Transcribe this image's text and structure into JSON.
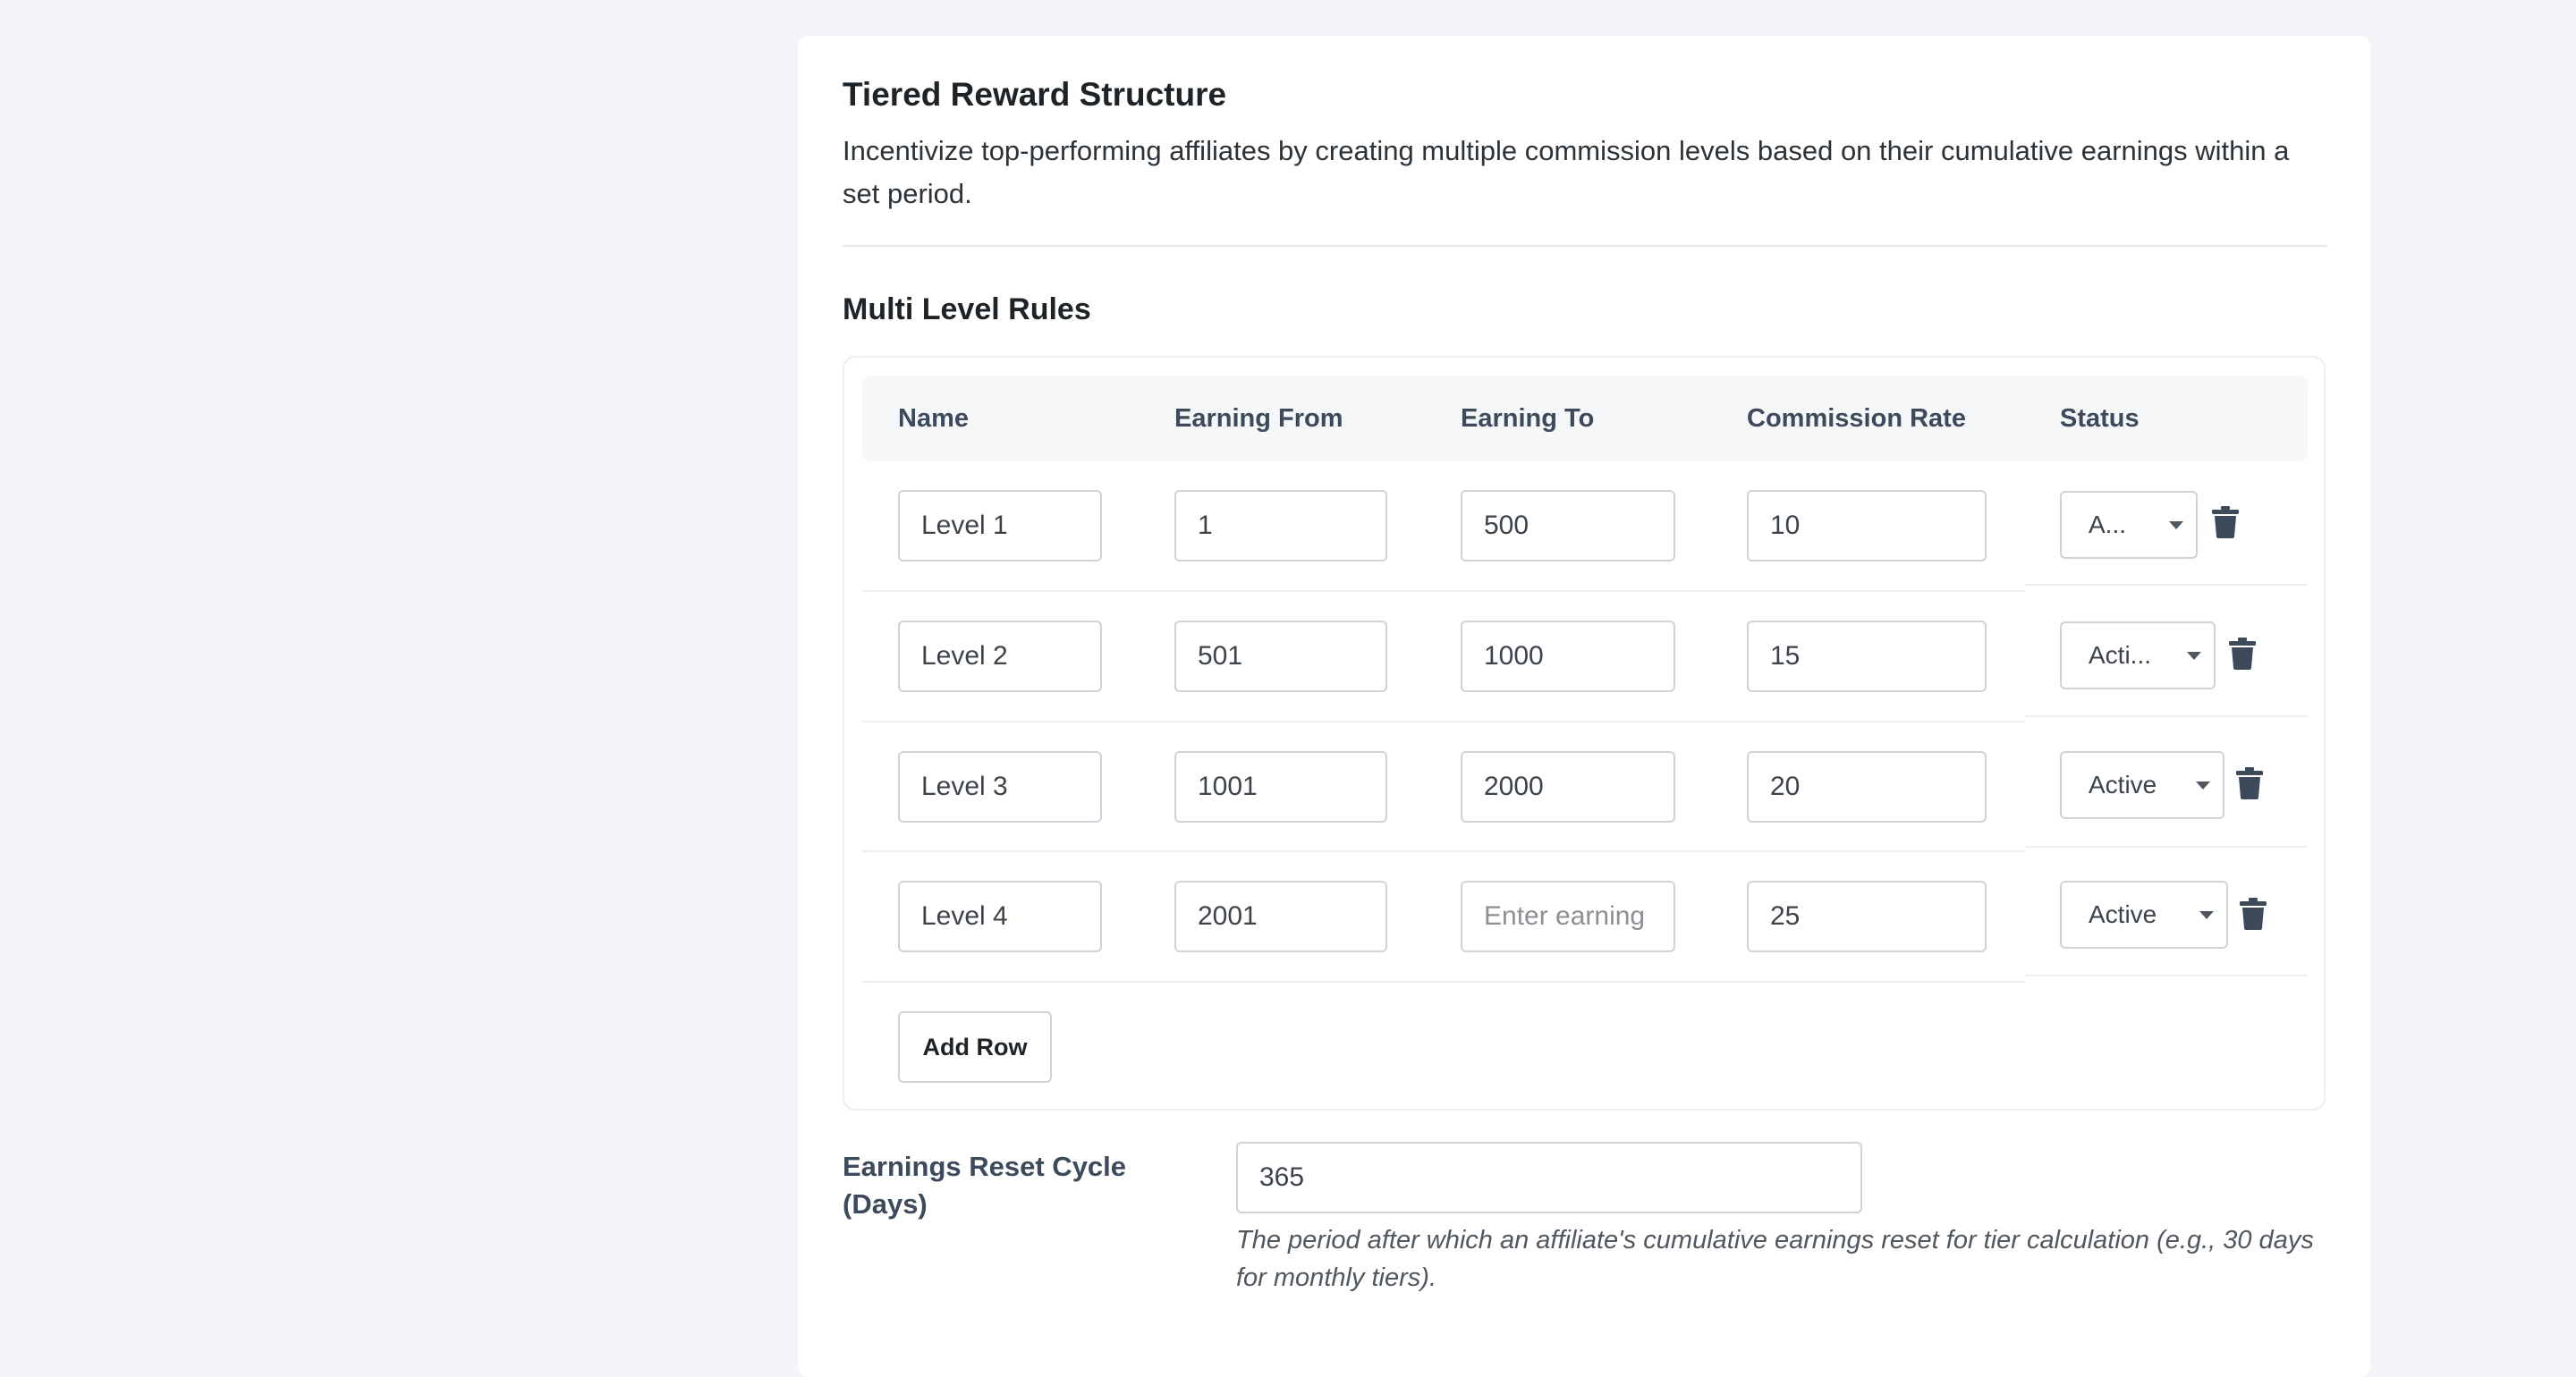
{
  "section": {
    "title": "Tiered Reward Structure",
    "description": "Incentivize top-performing affiliates by creating multiple commission levels based on their cumulative earnings within a set period."
  },
  "rules": {
    "title": "Multi Level Rules",
    "columns": [
      "Name",
      "Earning From",
      "Earning To",
      "Commission Rate",
      "Status"
    ],
    "rows": [
      {
        "name": "Level 1",
        "from": "1",
        "to": "500",
        "rate": "10",
        "status": "A..."
      },
      {
        "name": "Level 2",
        "from": "501",
        "to": "1000",
        "rate": "15",
        "status": "Acti..."
      },
      {
        "name": "Level 3",
        "from": "1001",
        "to": "2000",
        "rate": "20",
        "status": "Active"
      },
      {
        "name": "Level 4",
        "from": "2001",
        "to": "",
        "to_placeholder": "Enter earning",
        "rate": "25",
        "status": "Active"
      }
    ],
    "add_row_label": "Add Row"
  },
  "reset": {
    "label": "Earnings Reset Cycle (Days)",
    "value": "365",
    "help": "The period after which an affiliate's cumulative earnings reset for tier calculation (e.g., 30 days for monthly tiers)."
  },
  "icons": {
    "delete": "trash-icon",
    "dropdown": "chevron-down-icon"
  },
  "colors": {
    "page_bg": "#f3f5f8",
    "card_bg": "#ffffff",
    "header_text": "#3c4a5c",
    "icon": "#3c4a5c"
  }
}
